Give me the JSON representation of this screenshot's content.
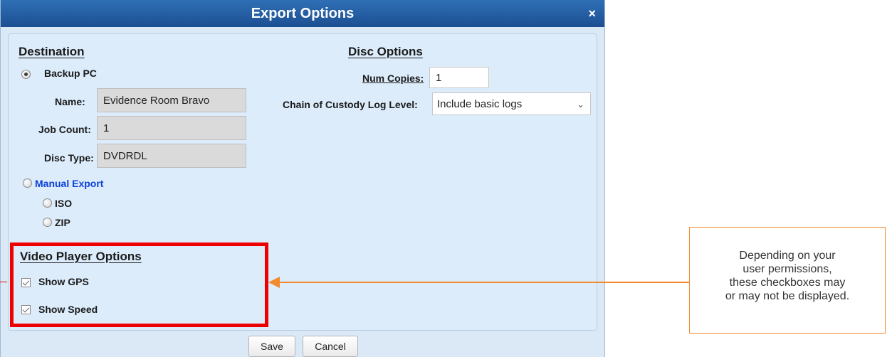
{
  "dialog": {
    "title": "Export Options",
    "close_glyph": "×"
  },
  "destination": {
    "heading": "Destination",
    "backup_pc_label": "Backup PC",
    "name_label": "Name:",
    "name_value": "Evidence Room Bravo",
    "job_count_label": "Job Count:",
    "job_count_value": "1",
    "disc_type_label": "Disc Type:",
    "disc_type_value": "DVDRDL",
    "manual_export_label": "Manual Export",
    "iso_label": "ISO",
    "zip_label": "ZIP",
    "selected": "Backup PC"
  },
  "disc_options": {
    "heading": "Disc Options",
    "num_copies_label": "Num Copies:",
    "num_copies_value": "1",
    "custody_label": "Chain of Custody Log Level:",
    "custody_value": "Include basic logs"
  },
  "video_player_options": {
    "heading": "Video Player Options",
    "show_gps_label": "Show GPS",
    "show_gps_checked": true,
    "show_speed_label": "Show Speed",
    "show_speed_checked": true
  },
  "buttons": {
    "save": "Save",
    "cancel": "Cancel"
  },
  "callout": {
    "line1": "Depending on your",
    "line2": "user permissions,",
    "line3": "these checkboxes may",
    "line4": "or may not be displayed."
  },
  "colors": {
    "titlebar": "#1c4f92",
    "dialog_bg": "#dbe9f7",
    "highlight_box": "#ee0000",
    "callout_accent": "#f28a2e",
    "link_blue": "#0b3fd6"
  },
  "icons": {
    "close": "close-icon",
    "dropdown": "chevron-down-icon",
    "checkbox": "checkmark-icon"
  }
}
